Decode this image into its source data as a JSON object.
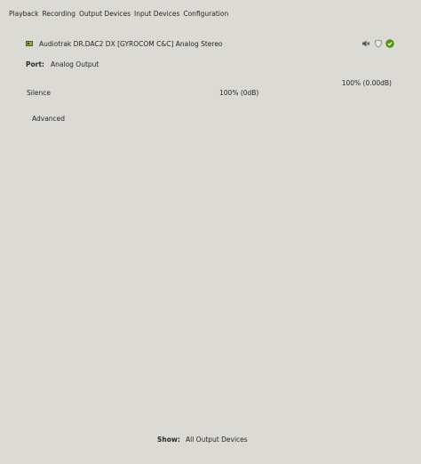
{
  "tabs": [
    {
      "label": "Playback"
    },
    {
      "label": "Recording"
    },
    {
      "label": "Output Devices"
    },
    {
      "label": "Input Devices"
    },
    {
      "label": "Configuration"
    }
  ],
  "device": {
    "name": "Audiotrak DR.DAC2 DX [GYROCOM C&C] Analog Stereo",
    "icon": "sound-card-icon",
    "port_label": "Port:",
    "port_value": "Analog Output",
    "volume_top": "100% (0.00dB)",
    "silence_label": "Silence",
    "volume_mid": "100% (0dB)",
    "advanced_label": "Advanced",
    "volume_level": 1.0
  },
  "footer": {
    "show_label": "Show:",
    "show_value": "All Output Devices"
  },
  "colors": {
    "background": "#dbdad5",
    "default_green": "#4e9a06"
  }
}
